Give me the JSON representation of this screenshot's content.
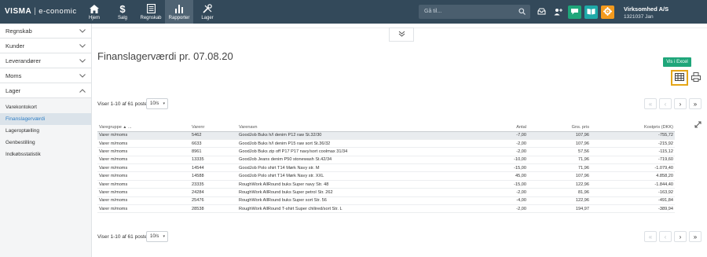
{
  "topbar": {
    "logo_brand": "VISMA",
    "logo_sep": "|",
    "logo_app": "e-conomic",
    "nav": [
      {
        "label": "Hjem",
        "icon": "home-icon"
      },
      {
        "label": "Salg",
        "icon": "dollar-icon"
      },
      {
        "label": "Regnskab",
        "icon": "ledger-icon"
      },
      {
        "label": "Rapporter",
        "icon": "bar-chart-icon"
      },
      {
        "label": "Lager",
        "icon": "tools-icon"
      }
    ],
    "search_placeholder": "Gå til...",
    "company_name": "Virksomhed A/S",
    "company_user": "1321037 Jan",
    "colors": {
      "bar": "#33495a",
      "green": "#1fa67a",
      "teal": "#1ea9a8",
      "orange": "#f39a1e"
    }
  },
  "sidebar": {
    "sections": [
      "Regnskab",
      "Kunder",
      "Leverandører",
      "Moms",
      "Lager"
    ],
    "lager_items": [
      "Varekontokort",
      "Finanslagerværdi",
      "Lageroptælling",
      "Genbestilling",
      "Indkøbsstatistik"
    ],
    "active_item": "Finanslagerværdi"
  },
  "main": {
    "title": "Finanslagerværdi pr. 07.08.20",
    "excel_label": "Vis i Excel",
    "paging_info": "Viser 1-10 af 61 poster",
    "page_size": "10/s",
    "columns": [
      "Varegruppe",
      "Varenr",
      "Varenavn",
      "Antal",
      "Gns. pris",
      "Kostpris (DKK)"
    ],
    "rows": [
      [
        "Varer m/moms",
        "5462",
        "GoodJob Buks h/l denim P12 raw St.32/30",
        "-7,00",
        "107,96",
        "-755,72"
      ],
      [
        "Varer m/moms",
        "6633",
        "GoodJob Buks h/l denim P15 raw sort St.36/32",
        "-2,00",
        "107,96",
        "-215,92"
      ],
      [
        "Varer m/moms",
        "8961",
        "GoodJob Buks zip off P17 P17 navy/sort coolmax 31/34",
        "-2,00",
        "57,56",
        "-115,12"
      ],
      [
        "Varer m/moms",
        "13335",
        "GoodJob Jeans denim P50 stonewash St.42/34",
        "-10,00",
        "71,96",
        "-719,60"
      ],
      [
        "Varer m/moms",
        "14544",
        "GoodJob Polo shirt T14 Mørk Navy str. M",
        "-15,00",
        "71,96",
        "-1.079,40"
      ],
      [
        "Varer m/moms",
        "14588",
        "GoodJob Polo shirt T14 Mørk Navy str. XXL",
        "45,00",
        "107,96",
        "4.858,20"
      ],
      [
        "Varer m/moms",
        "23335",
        "RoughWork AllRound buks Super navy Str. 48",
        "-15,00",
        "122,96",
        "-1.844,40"
      ],
      [
        "Varer m/moms",
        "24284",
        "RoughWork AllRound buks Super petrol Str. 262",
        "-2,00",
        "81,96",
        "-163,92"
      ],
      [
        "Varer m/moms",
        "25476",
        "RoughWork AllRound buks Super sort Str. 56",
        "-4,00",
        "122,96",
        "-491,84"
      ],
      [
        "Varer m/moms",
        "28538",
        "RoughWork AllRound T-shirt Super chilired/sort Str. L",
        "-2,00",
        "194,97",
        "-389,94"
      ]
    ]
  }
}
